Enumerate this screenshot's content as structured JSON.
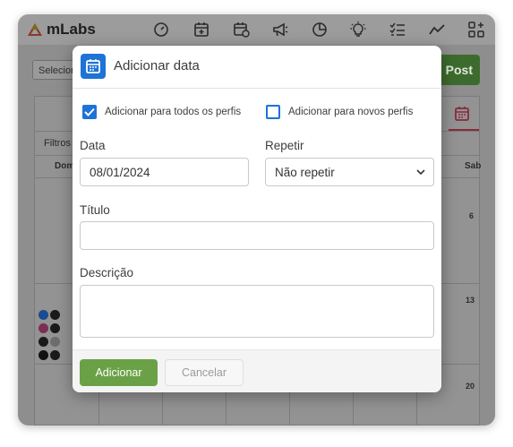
{
  "app": {
    "logo_text": "mLabs"
  },
  "background": {
    "select_label": "Selecionar",
    "post_button": "Post",
    "filters_label": "Filtros",
    "day_first": "Dom",
    "day_last": "Sab",
    "day_numbers": [
      "6",
      "13",
      "20"
    ]
  },
  "modal": {
    "title": "Adicionar data",
    "checkbox_all_profiles": {
      "label": "Adicionar para todos os perfis",
      "checked": true
    },
    "checkbox_new_profiles": {
      "label": "Adicionar para novos perfis",
      "checked": false
    },
    "date": {
      "label": "Data",
      "value": "08/01/2024"
    },
    "repeat": {
      "label": "Repetir",
      "value": "Não repetir"
    },
    "title_field": {
      "label": "Título",
      "value": "",
      "placeholder": ""
    },
    "description_field": {
      "label": "Descrição",
      "value": "",
      "placeholder": ""
    },
    "add_button": "Adicionar",
    "cancel_button": "Cancelar"
  },
  "colors": {
    "accent_blue": "#1d73d6",
    "primary_green": "#6aa146",
    "calendar_red": "#8a2a3c"
  },
  "icons": {
    "nav": [
      "dashboard-icon",
      "calendar-add-icon",
      "calendar-clock-icon",
      "megaphone-icon",
      "pie-chart-icon",
      "lightbulb-icon",
      "checklist-icon",
      "trend-icon",
      "grid-plus-icon"
    ]
  }
}
